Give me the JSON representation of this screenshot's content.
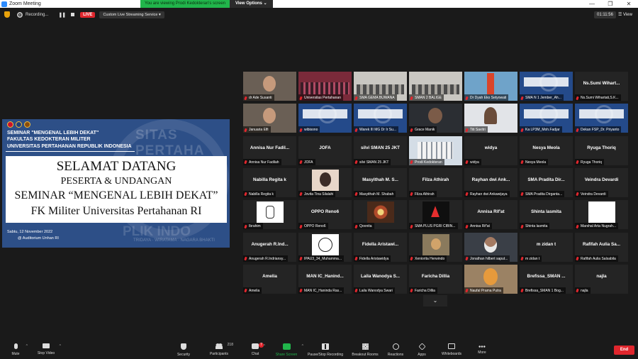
{
  "window": {
    "title": "Zoom Meeting",
    "minimize_glyph": "—",
    "maximize_glyph": "❐",
    "close_glyph": "✕"
  },
  "share_banner": {
    "viewing_text": "You are viewing Prodi Kedokteran's screen",
    "view_options": "View Options ⌄"
  },
  "recording": {
    "label": "Recording...",
    "pause_glyph": "❚❚",
    "live_label": "LIVE",
    "stream_label": "Custom Live Streaming Service ▾",
    "timer": "01:11:56",
    "view_label": "☰ View"
  },
  "slide": {
    "watermark_top": "SITAS PERTAHA",
    "watermark_bottom": "PLIK INDO",
    "watermark_motto": "TRIDAYA · WIRATAMA · NAGARA BHAKTI",
    "header_line1": "SEMINAR  \"MENGENAL LEBIH DEKAT\"",
    "header_line2": "FAKULTAS KEDOKTERAN MILITER",
    "header_line3": "UNIVERSITAS PERTAHANAN REPUBLIK INDONESIA",
    "title": "SELAMAT DATANG",
    "subtitle": "PESERTA & UNDANGAN",
    "line3": "SEMINAR “MENGENAL LEBIH DEKAT”",
    "line4": "FK Militer Universitas Pertahanan RI",
    "date": "Sabtu, 12 November 2022",
    "venue": "@ Auditorium Unhan RI"
  },
  "participants": [
    [
      {
        "name": "dr Ade Susanti",
        "v": "face"
      },
      {
        "name": "Universitas Pertahanan",
        "v": "crowd",
        "hl": true
      },
      {
        "name": "SMA GEMA BUWANA",
        "v": "room"
      },
      {
        "name": "SMAN 2 BALIGE",
        "v": "room"
      },
      {
        "name": "Dr Dyah Eko Setyowati",
        "v": "bridge"
      },
      {
        "name": "SMA N 1 Jember_Ah...",
        "v": "slide"
      },
      {
        "name": "Ns.Sumi Wihartati,S.K...",
        "big": "Ns.Sumi  Wihart..."
      }
    ],
    [
      {
        "name": "Januaria Elfi",
        "v": "face"
      },
      {
        "name": "wibisono",
        "v": "slide"
      },
      {
        "name": "Warek III MG Dr Ir Su...",
        "v": "slide"
      },
      {
        "name": "Grace Manik",
        "v": "dark"
      },
      {
        "name": "Titi Savitri",
        "v": "person"
      },
      {
        "name": "Ka LP3M_Moh.Fadjar",
        "v": "slide"
      },
      {
        "name": "Dekan FSP_Dr. Priyanto",
        "v": "slide"
      }
    ],
    [
      {
        "name": "Annisa Nur Fadilah",
        "big": "Annisa Nur Fadil..."
      },
      {
        "name": "JOFA",
        "big": "JOFA"
      },
      {
        "name": "silvi SMAN 25 JKT",
        "big": "silvi SMAN 25 JKT"
      },
      {
        "name": "Prodi Kedokteran",
        "v": "building"
      },
      {
        "name": "widya",
        "big": "widya"
      },
      {
        "name": "Nesya Meola",
        "big": "Nesya Meola"
      },
      {
        "name": "Ryuga Thoriq",
        "big": "Ryuga Thoriq"
      }
    ],
    [
      {
        "name": "Nabilla Regita k",
        "big": "Nabilla Regita k"
      },
      {
        "name": "Jovita Tina Silalahi",
        "pic": "portrait"
      },
      {
        "name": "Masyithah M. Shabah",
        "big": "Masyithah  M.  S..."
      },
      {
        "name": "Filza Athirah",
        "big": "Filza Athirah"
      },
      {
        "name": "Rayhan dwi Ankawijaya",
        "big": "Rayhan  dwi  Ank..."
      },
      {
        "name": "SMA Pradita Dirganta...",
        "big": "SMA  Pradita  Dir..."
      },
      {
        "name": "Veindra Devardi",
        "big": "Veindra Devardi"
      }
    ],
    [
      {
        "name": "Ibrahim",
        "pic": "sketch"
      },
      {
        "name": "OPPO Reno6",
        "big": "OPPO Reno6"
      },
      {
        "name": "Qoonita",
        "pic": "flower"
      },
      {
        "name": "SMA PLUS PGRI CIBIN...",
        "pic": "logo"
      },
      {
        "name": "Annisa Rif'at",
        "big": "Annisa Rif'at"
      },
      {
        "name": "Shinta lasmita",
        "big": "Shinta lasmita"
      },
      {
        "name": "Marshal Arta Nugrah...",
        "pic": "white"
      }
    ],
    [
      {
        "name": "Anugerah R.Indriansy...",
        "big": "Anugerah  R.Ind..."
      },
      {
        "name": "IPAU3_34_Muhamma...",
        "pic": "cartoon"
      },
      {
        "name": "Fidella Aristawidya",
        "big": "Fidella  Aristawi..."
      },
      {
        "name": "Xeniorita Herwindo",
        "pic": "cat"
      },
      {
        "name": "Jonathan hilbert saput...",
        "v": "mask"
      },
      {
        "name": "m zidan t",
        "big": "m zidan t"
      },
      {
        "name": "Rafifah Aulia Salsabila",
        "big": "Rafifah  Aulia  Sa..."
      }
    ],
    [
      {
        "name": "Amelia",
        "big": "Amelia"
      },
      {
        "name": "MAN IC_Haninda Ras...",
        "big": "MAN  IC_Hanind..."
      },
      {
        "name": "Laila Wanodya Swari",
        "big": "Laila  Wanodya  S..."
      },
      {
        "name": "Faricha Dillia",
        "big": "Faricha Dillia"
      },
      {
        "name": "Naufal Prama Putra",
        "v": "orange"
      },
      {
        "name": "Brefissa_SMAN 1 Bog...",
        "big": "Brefissa_SMAN ..."
      },
      {
        "name": "najla",
        "big": "najla"
      }
    ]
  ],
  "pager": {
    "down_glyph": "⌄"
  },
  "toolbar": {
    "mute": "Mute",
    "stop_video": "Stop Video",
    "security": "Security",
    "participants": "Participants",
    "participants_count": "218",
    "chat": "Chat",
    "chat_badge": "7",
    "share_screen": "Share Screen",
    "pause_recording": "Pause/Stop Recording",
    "breakout": "Breakout Rooms",
    "reactions": "Reactions",
    "apps": "Apps",
    "whiteboards": "Whiteboards",
    "more": "More",
    "end": "End",
    "caret": "^"
  },
  "colors": {
    "accent": "#2D8CFF",
    "live": "#e0262d",
    "share_green": "#21b54b",
    "highlight": "#d6e02a",
    "slide_bg": "#2d4f87"
  }
}
